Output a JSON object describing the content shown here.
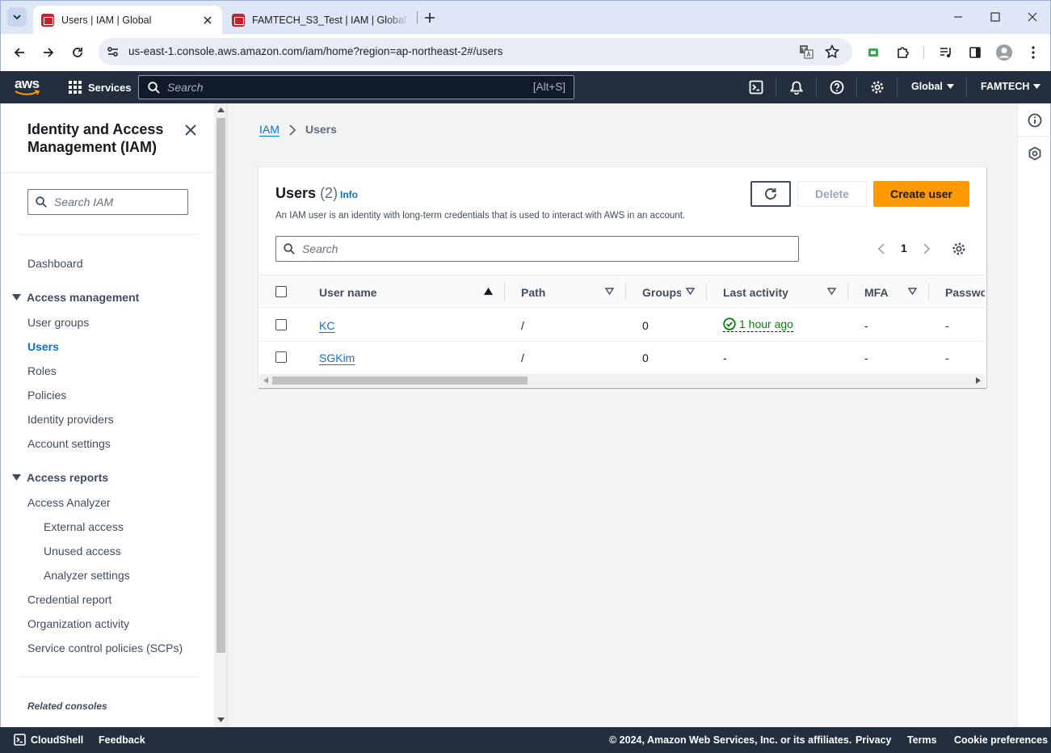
{
  "browser": {
    "tabs": [
      {
        "title": "Users | IAM | Global",
        "active": true
      },
      {
        "title": "FAMTECH_S3_Test | IAM | Global",
        "active": false
      }
    ],
    "url": "us-east-1.console.aws.amazon.com/iam/home?region=ap-northeast-2#/users"
  },
  "aws_nav": {
    "logo": "aws",
    "services_label": "Services",
    "search_placeholder": "Search",
    "search_shortcut": "[Alt+S]",
    "region": "Global",
    "account": "FAMTECH"
  },
  "sidebar": {
    "title": "Identity and Access Management (IAM)",
    "search_placeholder": "Search IAM",
    "dashboard": "Dashboard",
    "access_management": {
      "label": "Access management",
      "items": [
        "User groups",
        "Users",
        "Roles",
        "Policies",
        "Identity providers",
        "Account settings"
      ],
      "active": "Users"
    },
    "access_reports": {
      "label": "Access reports",
      "items": [
        "Access Analyzer",
        "External access",
        "Unused access",
        "Analyzer settings",
        "Credential report",
        "Organization activity",
        "Service control policies (SCPs)"
      ]
    },
    "related_consoles": "Related consoles"
  },
  "breadcrumb": {
    "root": "IAM",
    "current": "Users"
  },
  "panel": {
    "title": "Users",
    "count": "(2)",
    "info": "Info",
    "description": "An IAM user is an identity with long-term credentials that is used to interact with AWS in an account.",
    "delete_label": "Delete",
    "create_label": "Create user",
    "search_placeholder": "Search",
    "page": "1",
    "columns": [
      "User name",
      "Path",
      "Groups",
      "Last activity",
      "MFA",
      "Password"
    ],
    "rows": [
      {
        "user_name": "KC",
        "path": "/",
        "groups": "0",
        "last_activity": "1 hour ago",
        "mfa": "-",
        "password": "-"
      },
      {
        "user_name": "SGKim",
        "path": "/",
        "groups": "0",
        "last_activity": "-",
        "mfa": "-",
        "password": "-"
      }
    ]
  },
  "footer": {
    "cloudshell": "CloudShell",
    "feedback": "Feedback",
    "copyright": "© 2024, Amazon Web Services, Inc. or its affiliates.",
    "privacy": "Privacy",
    "terms": "Terms",
    "cookies": "Cookie preferences"
  },
  "colors": {
    "aws_nav": "#232f3e",
    "link": "#0972d3",
    "primary_button": "#ff9900",
    "success": "#037f0c"
  }
}
